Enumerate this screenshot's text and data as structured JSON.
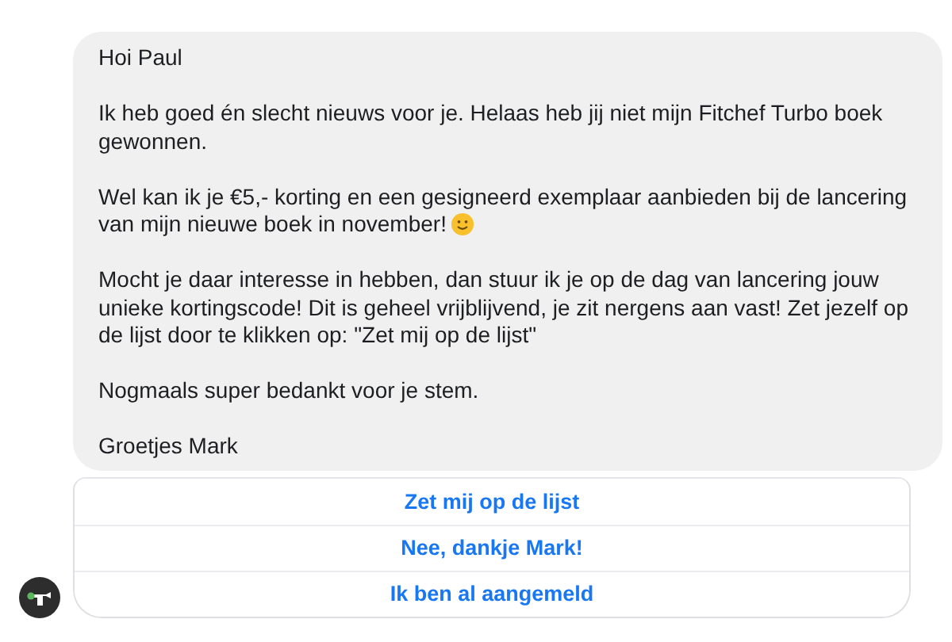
{
  "message": {
    "paragraphs": [
      {
        "text": "Hoi Paul",
        "smiley": false
      },
      {
        "text": "Ik heb goed én slecht nieuws voor je. Helaas heb jij niet mijn Fitchef Turbo boek gewonnen.",
        "smiley": false
      },
      {
        "text": "Wel kan ik je €5,- korting en een gesigneerd exemplaar aanbieden bij de lancering van mijn nieuwe boek in november!",
        "smiley": true
      },
      {
        "text": "Mocht je daar interesse in hebben, dan stuur ik je op de dag van lancering jouw unieke kortingscode! Dit is geheel vrijblijvend, je zit nergens aan vast! Zet jezelf op de lijst door te klikken op: \"Zet mij op de lijst\"",
        "smiley": false
      },
      {
        "text": "Nogmaals super bedankt voor je stem.",
        "smiley": false
      },
      {
        "text": "Groetjes Mark",
        "smiley": false
      }
    ]
  },
  "quick_replies": [
    "Zet mij op de lijst",
    "Nee, dankje Mark!",
    "Ik ben al aangemeld"
  ]
}
